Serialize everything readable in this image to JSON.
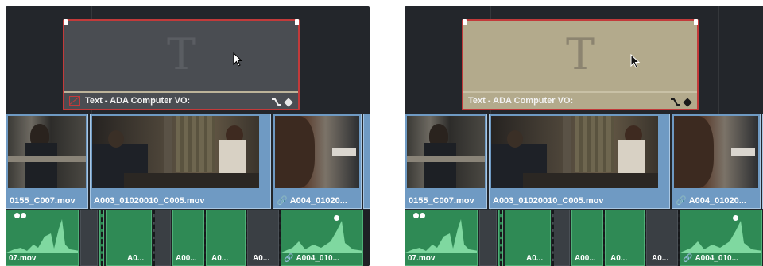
{
  "panels": [
    {
      "id": "before",
      "title_clip": {
        "label": "Text - ADA Computer VO:",
        "glyph": "T",
        "state": "disabled",
        "fill": "#4a4d52",
        "glyph_color": "#5a5d62"
      },
      "video_clips": [
        {
          "label": "0155_C007.mov",
          "linked": false
        },
        {
          "label": "A003_01020010_C005.mov",
          "linked": false
        },
        {
          "label": "A004_01020...",
          "linked": true
        }
      ],
      "audio_clips": [
        {
          "label": "07.mov"
        },
        {
          "label": "A0..."
        },
        {
          "label": "A00..."
        },
        {
          "label": "A0..."
        },
        {
          "label": "A0..."
        },
        {
          "label": "A004_010...",
          "linked": true
        }
      ]
    },
    {
      "id": "after",
      "title_clip": {
        "label": "Text - ADA Computer VO:",
        "glyph": "T",
        "state": "enabled",
        "fill": "#b3aa8c",
        "glyph_color": "#8c8470"
      },
      "video_clips": [
        {
          "label": "0155_C007.mov",
          "linked": false
        },
        {
          "label": "A003_01020010_C005.mov",
          "linked": false
        },
        {
          "label": "A004_01020...",
          "linked": true
        }
      ],
      "audio_clips": [
        {
          "label": "07.mov"
        },
        {
          "label": "A0..."
        },
        {
          "label": "A00..."
        },
        {
          "label": "A0..."
        },
        {
          "label": "A0..."
        },
        {
          "label": "A004_010...",
          "linked": true
        }
      ]
    }
  ],
  "colors": {
    "timeline_bg": "#23262b",
    "selection_border": "#c23a3a",
    "video_clip": "#6f9ac3",
    "audio_clip": "#2f8a55",
    "playhead": "#c23a3a"
  },
  "icons": {
    "link": "🔗",
    "keyframe": "keyframe-icon",
    "curve": "curve-icon",
    "cursor": "mouse-cursor-icon"
  }
}
